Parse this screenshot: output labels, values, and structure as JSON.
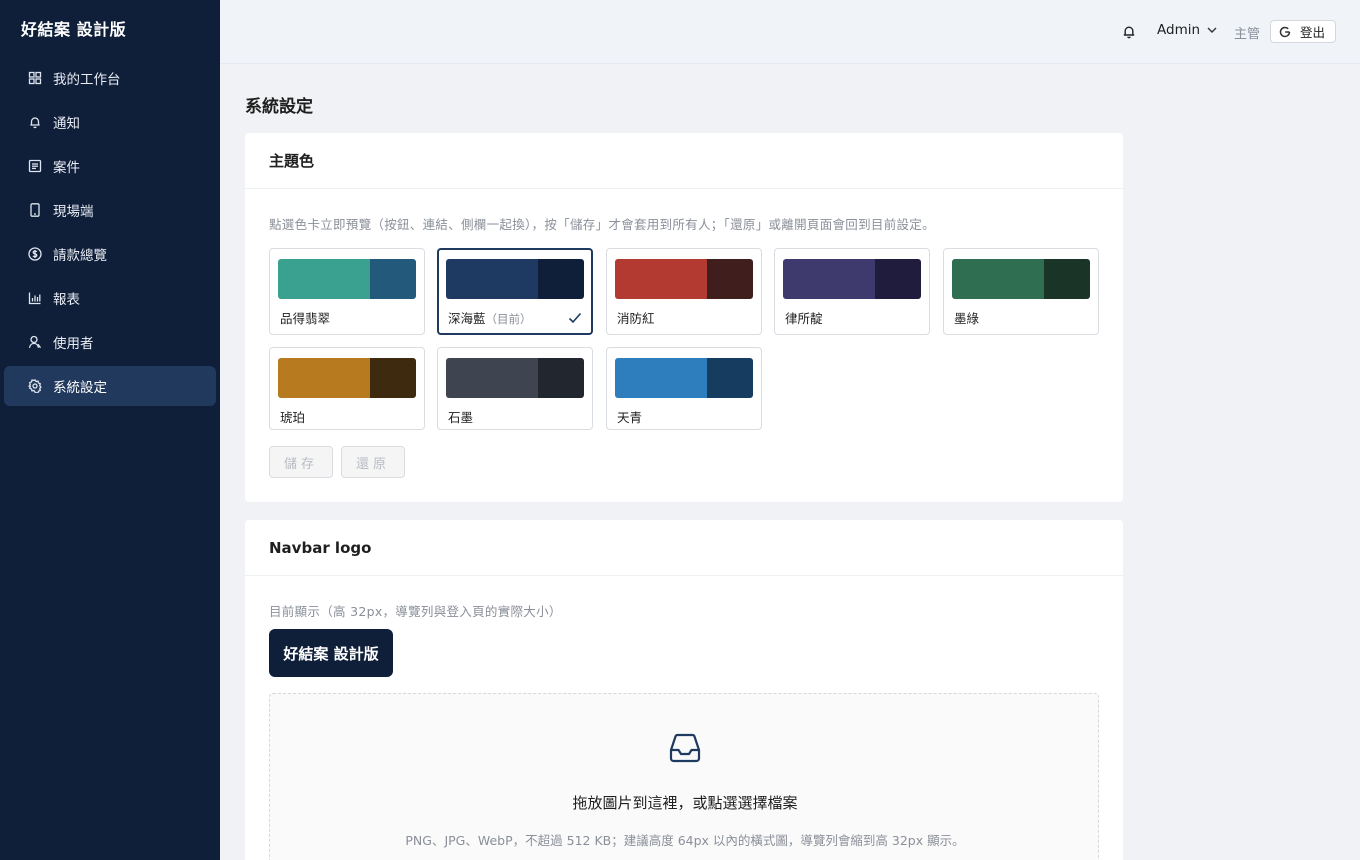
{
  "sidebar": {
    "brand": "好結案 設計版",
    "items": [
      {
        "label": "我的工作台",
        "icon": "grid-icon"
      },
      {
        "label": "通知",
        "icon": "bell-icon"
      },
      {
        "label": "案件",
        "icon": "document-icon"
      },
      {
        "label": "現場端",
        "icon": "mobile-icon"
      },
      {
        "label": "請款總覽",
        "icon": "dollar-icon"
      },
      {
        "label": "報表",
        "icon": "bar-chart-icon"
      },
      {
        "label": "使用者",
        "icon": "user-icon"
      },
      {
        "label": "系統設定",
        "icon": "gear-icon",
        "active": true
      }
    ]
  },
  "header": {
    "user": "Admin",
    "role": "主管",
    "logout": "登出"
  },
  "page": {
    "title": "系統設定"
  },
  "theme": {
    "title": "主題色",
    "hint": "點選色卡立即預覽（按鈕、連結、側欄一起換），按「儲存」才會套用到所有人；「還原」或離開頁面會回到目前設定。",
    "current_tag": "（目前）",
    "swatches": [
      {
        "name": "品得翡翠",
        "primary": "#3aa090",
        "secondary": "#235a7c"
      },
      {
        "name": "深海藍",
        "primary": "#1f3a62",
        "secondary": "#0f1f3a",
        "current": true
      },
      {
        "name": "消防紅",
        "primary": "#b23a30",
        "secondary": "#401e1e"
      },
      {
        "name": "律所靛",
        "primary": "#3e3a6e",
        "secondary": "#201c3e"
      },
      {
        "name": "墨綠",
        "primary": "#2f6e50",
        "secondary": "#1a3528"
      },
      {
        "name": "琥珀",
        "primary": "#b87a1e",
        "secondary": "#3e2a0e"
      },
      {
        "name": "石墨",
        "primary": "#3e4450",
        "secondary": "#22262e"
      },
      {
        "name": "天青",
        "primary": "#2e7dbc",
        "secondary": "#163c60"
      }
    ],
    "save_label": "儲存",
    "reset_label": "還原"
  },
  "navbar_logo": {
    "title": "Navbar logo",
    "hint": "目前顯示（高 32px，導覽列與登入頁的實際大小）",
    "preview_text": "好結案 設計版",
    "drop_text": "拖放圖片到這裡，或點選選擇檔案",
    "drop_sub": "PNG、JPG、WebP，不超過 512 KB；建議高度 64px 以內的橫式圖，導覽列會縮到高 32px 顯示。"
  }
}
